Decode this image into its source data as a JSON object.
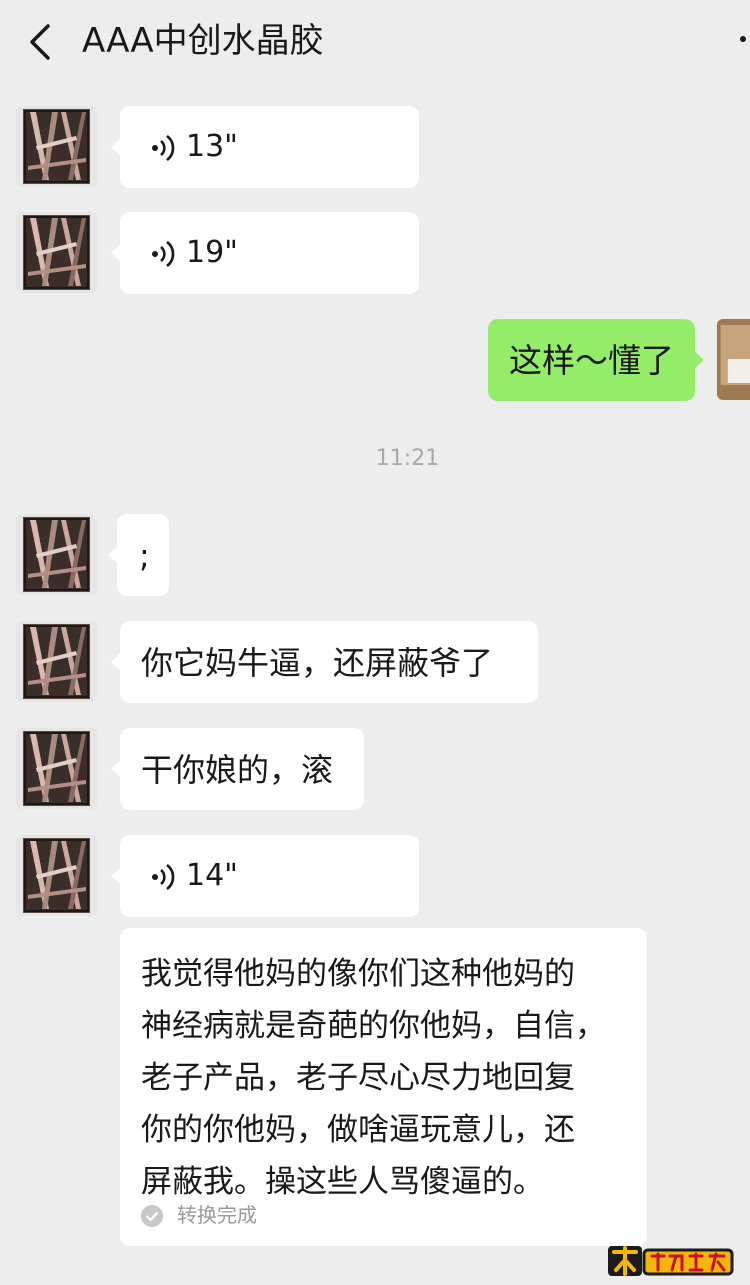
{
  "header": {
    "title": "AAA中创水晶胶",
    "back_icon": "chevron-left-icon",
    "more_icon": "more-dots-icon"
  },
  "messages": [
    {
      "type": "voice",
      "direction": "incoming",
      "duration": "13\""
    },
    {
      "type": "voice",
      "direction": "incoming",
      "duration": "19\""
    },
    {
      "type": "text",
      "direction": "outgoing",
      "text": "这样～懂了"
    },
    {
      "type": "time",
      "text": "11:21"
    },
    {
      "type": "text",
      "direction": "incoming",
      "text": ";"
    },
    {
      "type": "text",
      "direction": "incoming",
      "text": "你它妈牛逼，还屏蔽爷了"
    },
    {
      "type": "text",
      "direction": "incoming",
      "text": "干你娘的，滚"
    },
    {
      "type": "voice",
      "direction": "incoming",
      "duration": "14\""
    }
  ],
  "transcription": {
    "lines": [
      "我觉得他妈的像你们这种他妈的",
      "神经病就是奇葩的你他妈，自信，",
      "老子产品，老子尽心尽力地回复",
      "你的你他妈，做啥逼玩意儿，还",
      "屏蔽我。操这些人骂傻逼的。"
    ],
    "status": "转换完成",
    "status_icon": "check-circle-icon"
  },
  "colors": {
    "background": "#ededed",
    "incoming_bubble": "#ffffff",
    "outgoing_bubble": "#95ec69",
    "timestamp": "#a8a8a8"
  },
  "watermark": {
    "text": "木工爱好者",
    "icon": "logo-watermark"
  }
}
